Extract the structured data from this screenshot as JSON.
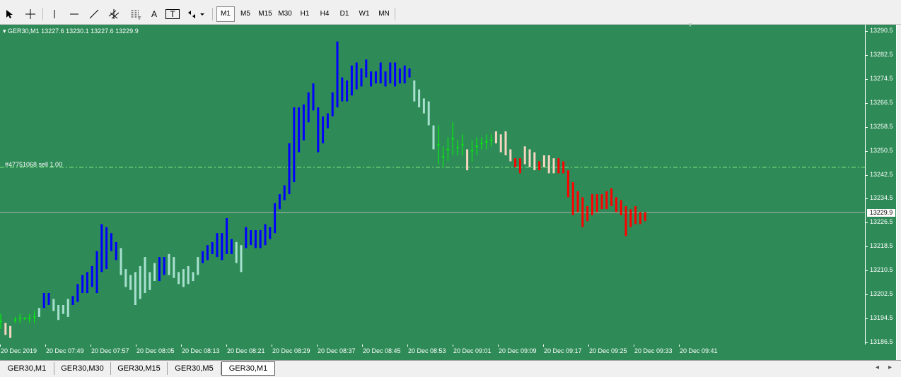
{
  "toolbar": {
    "tools": [
      {
        "name": "cursor-icon"
      },
      {
        "name": "crosshair-icon"
      },
      {
        "name": "vertical-line-icon"
      },
      {
        "name": "horizontal-line-icon"
      },
      {
        "name": "trendline-icon"
      },
      {
        "name": "channel-icon"
      },
      {
        "name": "fibonacci-icon"
      },
      {
        "name": "text-icon",
        "label": "A"
      },
      {
        "name": "text-label-icon",
        "label": "T"
      },
      {
        "name": "shapes-icon"
      }
    ],
    "timeframes": [
      "M1",
      "M5",
      "M15",
      "M30",
      "H1",
      "H4",
      "D1",
      "W1",
      "MN"
    ],
    "active_timeframe": "M1"
  },
  "chart": {
    "header": "GER30,M1  13227.6 13230.1 13227.6 13229.9",
    "order_label": "#47751068 sell 1.00",
    "current_price": "13229.9",
    "background_color": "#2e8b57",
    "colors": {
      "up_strong": "#0000ff",
      "up": "#ff0000",
      "neutral_light": "#a8e0d0",
      "neutral_warm": "#f5d5c0",
      "sideways": "#00ff00"
    }
  },
  "chart_data": {
    "type": "bar",
    "y_axis_labels": [
      "13290.5",
      "13282.5",
      "13274.5",
      "13266.5",
      "13258.5",
      "13250.5",
      "13242.5",
      "13234.5",
      "13226.5",
      "13218.5",
      "13210.5",
      "13202.5",
      "13194.5",
      "13186.5"
    ],
    "x_axis_labels": [
      "20 Dec 2019",
      "20 Dec 07:49",
      "20 Dec 07:57",
      "20 Dec 08:05",
      "20 Dec 08:13",
      "20 Dec 08:21",
      "20 Dec 08:29",
      "20 Dec 08:37",
      "20 Dec 08:45",
      "20 Dec 08:53",
      "20 Dec 09:01",
      "20 Dec 09:09",
      "20 Dec 09:17",
      "20 Dec 09:25",
      "20 Dec 09:33",
      "20 Dec 09:41"
    ],
    "ylim": [
      13186.5,
      13290.5
    ],
    "order_line_price": 13245.0,
    "current_price_line": 13229.9,
    "bars": [
      {
        "low": 13191,
        "high": 13196,
        "c": "g"
      },
      {
        "low": 13189,
        "high": 13193,
        "c": "w"
      },
      {
        "low": 13188,
        "high": 13192,
        "c": "w"
      },
      {
        "low": 13193,
        "high": 13195,
        "c": "g"
      },
      {
        "low": 13193,
        "high": 13196,
        "c": "g"
      },
      {
        "low": 13194,
        "high": 13195,
        "c": "g"
      },
      {
        "low": 13193,
        "high": 13196,
        "c": "g"
      },
      {
        "low": 13193,
        "high": 13197,
        "c": "g"
      },
      {
        "low": 13195,
        "high": 13198,
        "c": "l"
      },
      {
        "low": 13198,
        "high": 13203,
        "c": "b"
      },
      {
        "low": 13199,
        "high": 13203,
        "c": "b"
      },
      {
        "low": 13197,
        "high": 13201,
        "c": "l"
      },
      {
        "low": 13194,
        "high": 13199,
        "c": "l"
      },
      {
        "low": 13196,
        "high": 13199,
        "c": "l"
      },
      {
        "low": 13195,
        "high": 13201,
        "c": "l"
      },
      {
        "low": 13199,
        "high": 13202,
        "c": "b"
      },
      {
        "low": 13200,
        "high": 13206,
        "c": "b"
      },
      {
        "low": 13203,
        "high": 13209,
        "c": "b"
      },
      {
        "low": 13203,
        "high": 13210,
        "c": "b"
      },
      {
        "low": 13205,
        "high": 13212,
        "c": "b"
      },
      {
        "low": 13203,
        "high": 13217,
        "c": "b"
      },
      {
        "low": 13210,
        "high": 13226,
        "c": "b"
      },
      {
        "low": 13211,
        "high": 13225,
        "c": "b"
      },
      {
        "low": 13217,
        "high": 13223,
        "c": "b"
      },
      {
        "low": 13214,
        "high": 13220,
        "c": "b"
      },
      {
        "low": 13209,
        "high": 13218,
        "c": "l"
      },
      {
        "low": 13205,
        "high": 13211,
        "c": "l"
      },
      {
        "low": 13204,
        "high": 13209,
        "c": "l"
      },
      {
        "low": 13199,
        "high": 13210,
        "c": "l"
      },
      {
        "low": 13201,
        "high": 13212,
        "c": "l"
      },
      {
        "low": 13203,
        "high": 13215,
        "c": "l"
      },
      {
        "low": 13204,
        "high": 13210,
        "c": "l"
      },
      {
        "low": 13207,
        "high": 13213,
        "c": "l"
      },
      {
        "low": 13207,
        "high": 13215,
        "c": "b"
      },
      {
        "low": 13209,
        "high": 13215,
        "c": "b"
      },
      {
        "low": 13209,
        "high": 13216,
        "c": "l"
      },
      {
        "low": 13208,
        "high": 13215,
        "c": "l"
      },
      {
        "low": 13206,
        "high": 13210,
        "c": "l"
      },
      {
        "low": 13205,
        "high": 13211,
        "c": "l"
      },
      {
        "low": 13206,
        "high": 13212,
        "c": "l"
      },
      {
        "low": 13207,
        "high": 13210,
        "c": "l"
      },
      {
        "low": 13209,
        "high": 13215,
        "c": "l"
      },
      {
        "low": 13213,
        "high": 13217,
        "c": "b"
      },
      {
        "low": 13214,
        "high": 13219,
        "c": "b"
      },
      {
        "low": 13216,
        "high": 13220,
        "c": "b"
      },
      {
        "low": 13215,
        "high": 13223,
        "c": "b"
      },
      {
        "low": 13214,
        "high": 13223,
        "c": "b"
      },
      {
        "low": 13216,
        "high": 13228,
        "c": "b"
      },
      {
        "low": 13216,
        "high": 13221,
        "c": "b"
      },
      {
        "low": 13213,
        "high": 13220,
        "c": "l"
      },
      {
        "low": 13210,
        "high": 13219,
        "c": "l"
      },
      {
        "low": 13218,
        "high": 13225,
        "c": "b"
      },
      {
        "low": 13219,
        "high": 13224,
        "c": "b"
      },
      {
        "low": 13218,
        "high": 13224,
        "c": "b"
      },
      {
        "low": 13218,
        "high": 13224,
        "c": "b"
      },
      {
        "low": 13219,
        "high": 13226,
        "c": "b"
      },
      {
        "low": 13221,
        "high": 13225,
        "c": "b"
      },
      {
        "low": 13223,
        "high": 13233,
        "c": "b"
      },
      {
        "low": 13231,
        "high": 13236,
        "c": "b"
      },
      {
        "low": 13234,
        "high": 13239,
        "c": "b"
      },
      {
        "low": 13236,
        "high": 13253,
        "c": "b"
      },
      {
        "low": 13240,
        "high": 13265,
        "c": "b"
      },
      {
        "low": 13250,
        "high": 13265,
        "c": "b"
      },
      {
        "low": 13254,
        "high": 13266,
        "c": "b"
      },
      {
        "low": 13260,
        "high": 13270,
        "c": "b"
      },
      {
        "low": 13264,
        "high": 13273,
        "c": "b"
      },
      {
        "low": 13250,
        "high": 13265,
        "c": "b"
      },
      {
        "low": 13253,
        "high": 13262,
        "c": "b"
      },
      {
        "low": 13258,
        "high": 13263,
        "c": "b"
      },
      {
        "low": 13262,
        "high": 13270,
        "c": "b"
      },
      {
        "low": 13265,
        "high": 13287,
        "c": "b"
      },
      {
        "low": 13267,
        "high": 13275,
        "c": "b"
      },
      {
        "low": 13267,
        "high": 13274,
        "c": "b"
      },
      {
        "low": 13269,
        "high": 13279,
        "c": "b"
      },
      {
        "low": 13271,
        "high": 13280,
        "c": "b"
      },
      {
        "low": 13272,
        "high": 13278,
        "c": "b"
      },
      {
        "low": 13275,
        "high": 13281,
        "c": "b"
      },
      {
        "low": 13272,
        "high": 13277,
        "c": "b"
      },
      {
        "low": 13273,
        "high": 13277,
        "c": "b"
      },
      {
        "low": 13273,
        "high": 13280,
        "c": "b"
      },
      {
        "low": 13272,
        "high": 13277,
        "c": "b"
      },
      {
        "low": 13273,
        "high": 13280,
        "c": "b"
      },
      {
        "low": 13272,
        "high": 13280,
        "c": "b"
      },
      {
        "low": 13273,
        "high": 13278,
        "c": "b"
      },
      {
        "low": 13273,
        "high": 13279,
        "c": "b"
      },
      {
        "low": 13275,
        "high": 13278,
        "c": "b"
      },
      {
        "low": 13267,
        "high": 13274,
        "c": "l"
      },
      {
        "low": 13265,
        "high": 13271,
        "c": "l"
      },
      {
        "low": 13263,
        "high": 13268,
        "c": "l"
      },
      {
        "low": 13259,
        "high": 13267,
        "c": "l"
      },
      {
        "low": 13251,
        "high": 13259,
        "c": "l"
      },
      {
        "low": 13246,
        "high": 13259,
        "c": "g"
      },
      {
        "low": 13245,
        "high": 13252,
        "c": "g"
      },
      {
        "low": 13247,
        "high": 13255,
        "c": "g"
      },
      {
        "low": 13249,
        "high": 13260,
        "c": "g"
      },
      {
        "low": 13249,
        "high": 13254,
        "c": "g"
      },
      {
        "low": 13249,
        "high": 13256,
        "c": "g"
      },
      {
        "low": 13244,
        "high": 13251,
        "c": "w"
      },
      {
        "low": 13247,
        "high": 13254,
        "c": "g"
      },
      {
        "low": 13249,
        "high": 13255,
        "c": "g"
      },
      {
        "low": 13251,
        "high": 13255,
        "c": "g"
      },
      {
        "low": 13251,
        "high": 13256,
        "c": "g"
      },
      {
        "low": 13252,
        "high": 13256,
        "c": "g"
      },
      {
        "low": 13253,
        "high": 13257,
        "c": "w"
      },
      {
        "low": 13250,
        "high": 13256,
        "c": "w"
      },
      {
        "low": 13249,
        "high": 13257,
        "c": "w"
      },
      {
        "low": 13247,
        "high": 13251,
        "c": "w"
      },
      {
        "low": 13245,
        "high": 13248,
        "c": "r"
      },
      {
        "low": 13243,
        "high": 13248,
        "c": "r"
      },
      {
        "low": 13246,
        "high": 13252,
        "c": "w"
      },
      {
        "low": 13245,
        "high": 13251,
        "c": "w"
      },
      {
        "low": 13244,
        "high": 13250,
        "c": "w"
      },
      {
        "low": 13244,
        "high": 13247,
        "c": "r"
      },
      {
        "low": 13245,
        "high": 13249,
        "c": "w"
      },
      {
        "low": 13243,
        "high": 13249,
        "c": "w"
      },
      {
        "low": 13243,
        "high": 13248,
        "c": "w"
      },
      {
        "low": 13243,
        "high": 13248,
        "c": "r"
      },
      {
        "low": 13243,
        "high": 13247,
        "c": "r"
      },
      {
        "low": 13235,
        "high": 13244,
        "c": "r"
      },
      {
        "low": 13229,
        "high": 13240,
        "c": "r"
      },
      {
        "low": 13230,
        "high": 13237,
        "c": "r"
      },
      {
        "low": 13225,
        "high": 13235,
        "c": "r"
      },
      {
        "low": 13227,
        "high": 13232,
        "c": "r"
      },
      {
        "low": 13229,
        "high": 13236,
        "c": "r"
      },
      {
        "low": 13230,
        "high": 13236,
        "c": "r"
      },
      {
        "low": 13231,
        "high": 13236,
        "c": "r"
      },
      {
        "low": 13231,
        "high": 13237,
        "c": "r"
      },
      {
        "low": 13232,
        "high": 13238,
        "c": "r"
      },
      {
        "low": 13230,
        "high": 13235,
        "c": "r"
      },
      {
        "low": 13229,
        "high": 13234,
        "c": "r"
      },
      {
        "low": 13222,
        "high": 13232,
        "c": "r"
      },
      {
        "low": 13225,
        "high": 13231,
        "c": "r"
      },
      {
        "low": 13226,
        "high": 13232,
        "c": "r"
      },
      {
        "low": 13226,
        "high": 13230,
        "c": "r"
      },
      {
        "low": 13227,
        "high": 13230,
        "c": "r"
      }
    ]
  },
  "tabs": [
    "GER30,M1",
    "GER30,M30",
    "GER30,M15",
    "GER30,M5",
    "GER30,M1"
  ],
  "active_tab": 4
}
